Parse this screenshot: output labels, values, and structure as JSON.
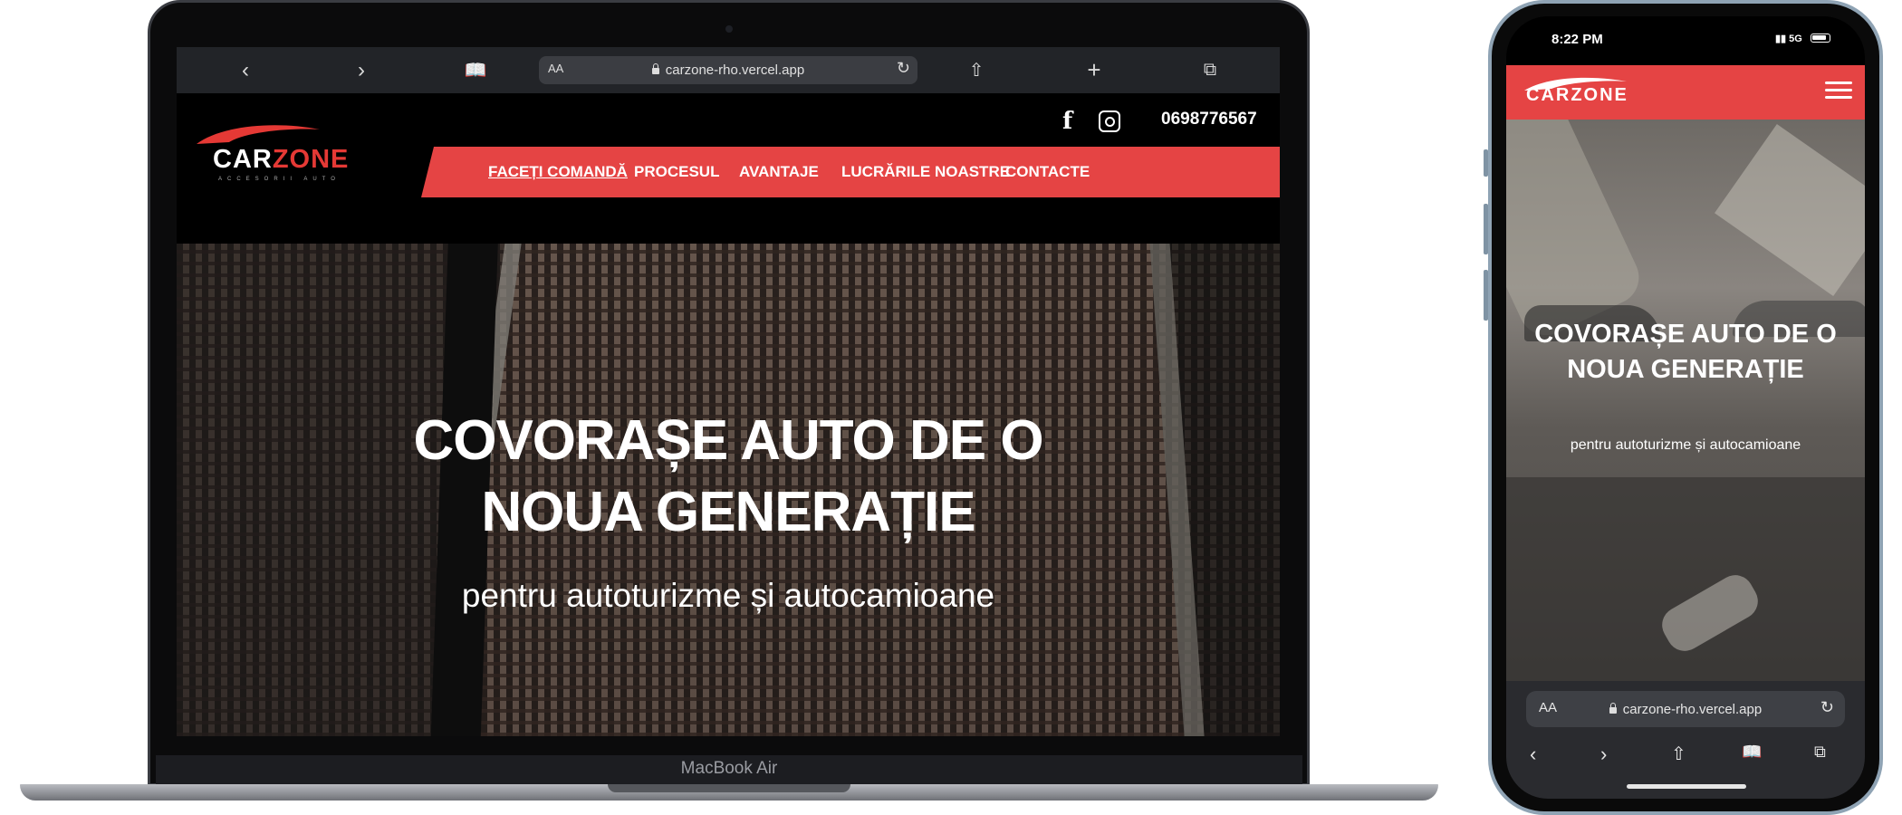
{
  "browser": {
    "url": "carzone-rho.vercel.app",
    "reader_label": "AA",
    "back_icon": "chevron-left-icon",
    "forward_icon": "chevron-right-icon",
    "bookmarks_icon": "book-icon",
    "share_icon": "share-icon",
    "new_tab_icon": "plus-icon",
    "tabs_icon": "tabs-icon",
    "reload_icon": "reload-icon"
  },
  "site": {
    "logo": {
      "part1": "CAR",
      "part2": "ZONE",
      "tagline": "ACCESORII AUTO"
    },
    "phone": "0698776567",
    "nav": [
      "FACEȚI COMANDĂ",
      "PROCESUL",
      "AVANTAJE",
      "LUCRĂRILE NOASTRE",
      "CONTACTE"
    ],
    "hero": {
      "title_line1": "COVORAȘE AUTO DE O",
      "title_line2": "NOUA GENERAȚIE",
      "subtitle": "pentru autoturizme și autocamioane"
    },
    "colors": {
      "accent": "#e54444",
      "background": "#000000",
      "text": "#ffffff"
    }
  },
  "device": {
    "laptop_model": "MacBook Air"
  },
  "mobile": {
    "status_time": "8:22 PM",
    "network": "5G",
    "logo": "CARZONE",
    "url": "carzone-rho.vercel.app",
    "reader_label": "AA"
  }
}
